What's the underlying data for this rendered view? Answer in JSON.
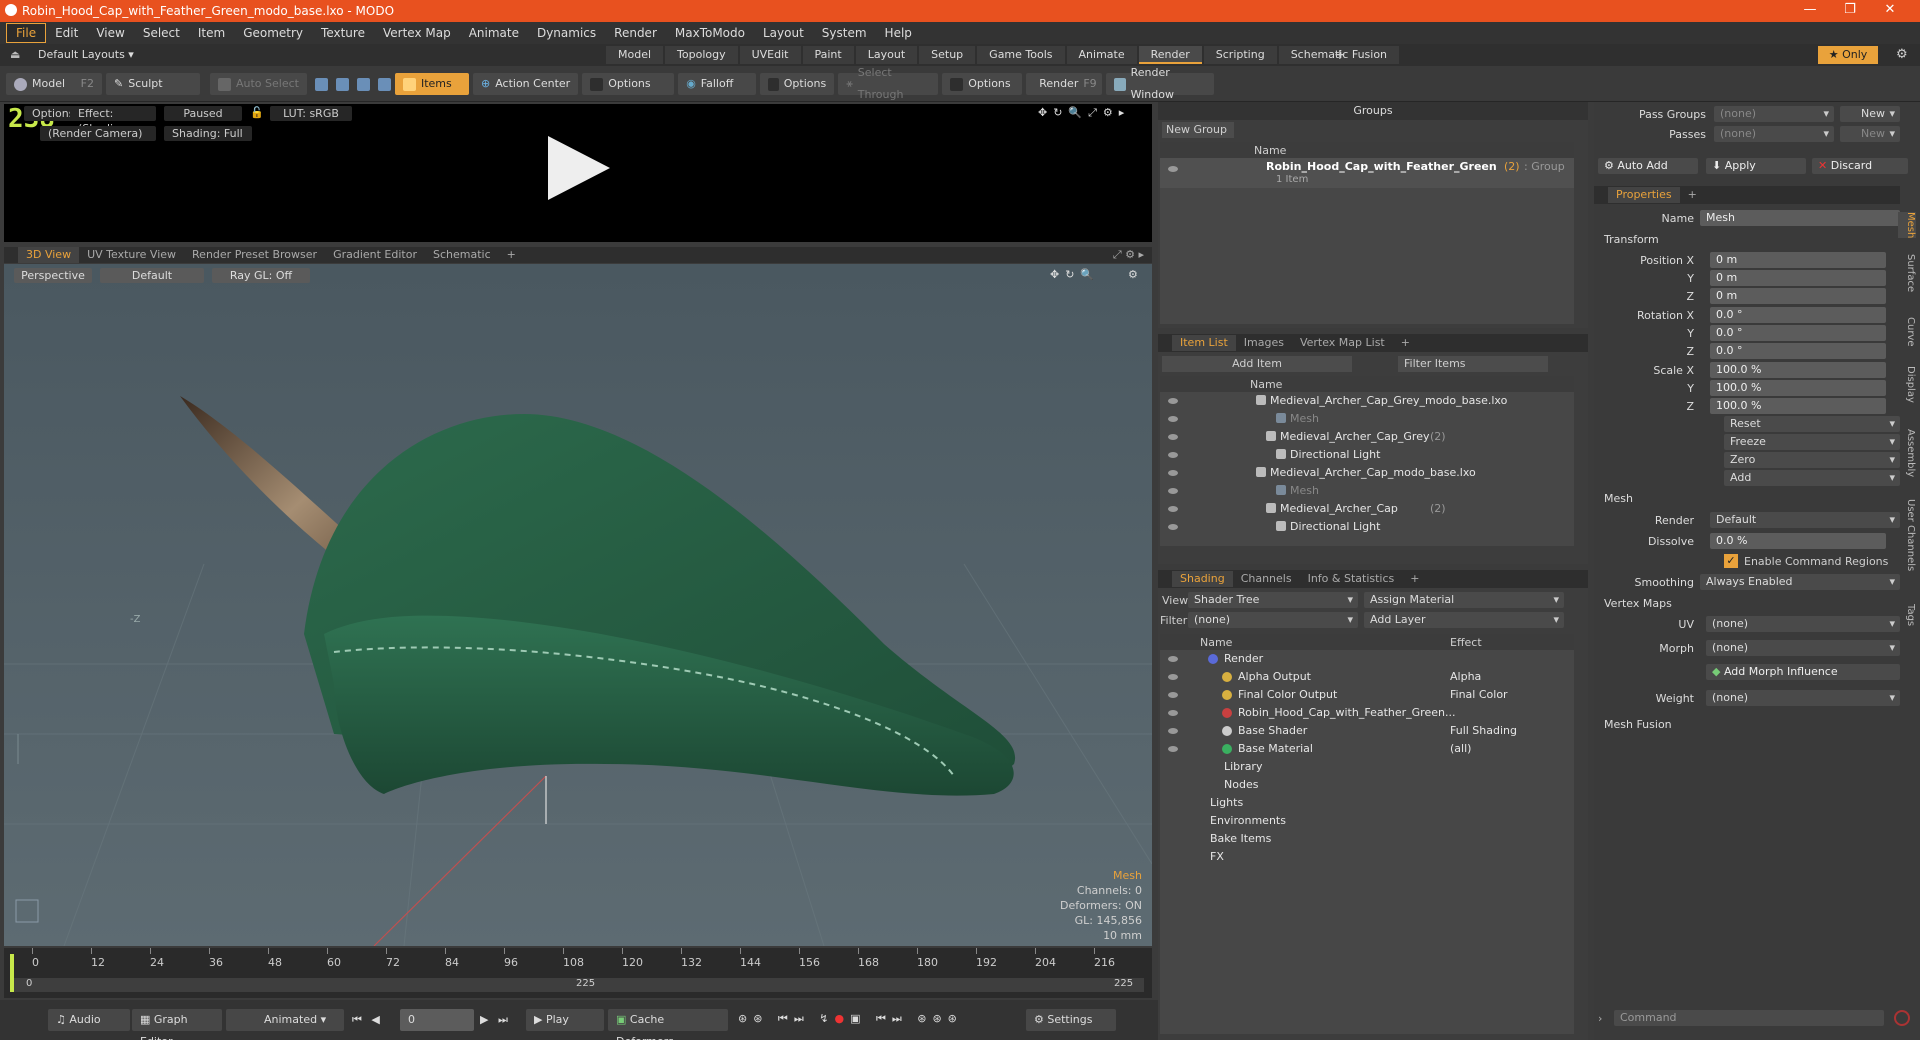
{
  "window": {
    "title": "Robin_Hood_Cap_with_Feather_Green_modo_base.lxo - MODO",
    "minimize": "—",
    "restore": "❐",
    "close": "✕"
  },
  "menu": [
    "File",
    "Edit",
    "View",
    "Select",
    "Item",
    "Geometry",
    "Texture",
    "Vertex Map",
    "Animate",
    "Dynamics",
    "Render",
    "MaxToModo",
    "Layout",
    "System",
    "Help"
  ],
  "layoutbar": {
    "layouts": "Default Layouts ▾",
    "tabs": [
      "Model",
      "Topology",
      "UVEdit",
      "Paint",
      "Layout",
      "Setup",
      "Game Tools",
      "Animate",
      "Render",
      "Scripting",
      "Schematic Fusion"
    ],
    "active": "Render",
    "plus": "+",
    "only": "★ Only"
  },
  "toolbar": {
    "model": "Model",
    "model_key": "F2",
    "sculpt": "Sculpt",
    "auto_select": "Auto Select",
    "items": "Items",
    "action_center": "Action Center",
    "options1": "Options",
    "falloff": "Falloff",
    "options2": "Options",
    "select_through": "Select Through",
    "options3": "Options",
    "render": "Render",
    "render_key": "F9",
    "render_window": "Render Window"
  },
  "preview": {
    "fps": "238",
    "options": "Options",
    "effect": "Effect: (Shadi...",
    "paused": "Paused",
    "lut": "LUT: sRGB",
    "camera": "(Render Camera)",
    "shading": "Shading: Full"
  },
  "viewtabs": {
    "tabs": [
      "3D View",
      "UV Texture View",
      "Render Preset Browser",
      "Gradient Editor",
      "Schematic"
    ],
    "active": "3D View",
    "plus": "+"
  },
  "viewport": {
    "perspective": "Perspective",
    "default": "Default",
    "raygl": "Ray GL: Off",
    "axis_label": "-Z",
    "stats": {
      "title": "Mesh",
      "channels": "Channels: 0",
      "deformers": "Deformers: ON",
      "gl": "GL: 145,856",
      "scale": "10 mm"
    }
  },
  "timeline": {
    "ticks": [
      "0",
      "12",
      "24",
      "36",
      "48",
      "60",
      "72",
      "84",
      "96",
      "108",
      "120",
      "132",
      "144",
      "156",
      "168",
      "180",
      "192",
      "204",
      "216"
    ],
    "low": "0",
    "mid": "225",
    "high": "225"
  },
  "bottombar": {
    "audio": "Audio",
    "graph_editor": "Graph Editor",
    "animated": "Animated",
    "frame": "0",
    "play": "Play",
    "cache_deformers": "Cache Deformers",
    "settings": "Settings"
  },
  "groups": {
    "title": "Groups",
    "new_group": "New Group",
    "col_name": "Name",
    "item_name": "Robin_Hood_Cap_with_Feather_Green",
    "item_count": "(2)",
    "item_type": ": Group",
    "item_sub": "1 Item"
  },
  "itemlist": {
    "tabs": [
      "Item List",
      "Images",
      "Vertex Map List"
    ],
    "plus": "+",
    "add_item": "Add Item",
    "filter": "Filter Items",
    "col_name": "Name",
    "rows": [
      {
        "label": "Medieval_Archer_Cap_Grey_modo_base.lxo",
        "indent": 0,
        "dim": false,
        "count": ""
      },
      {
        "label": "Mesh",
        "indent": 2,
        "dim": true,
        "count": ""
      },
      {
        "label": "Medieval_Archer_Cap_Grey",
        "indent": 1,
        "dim": false,
        "count": "(2)"
      },
      {
        "label": "Directional Light",
        "indent": 2,
        "dim": false,
        "count": ""
      },
      {
        "label": "Medieval_Archer_Cap_modo_base.lxo",
        "indent": 0,
        "dim": false,
        "count": ""
      },
      {
        "label": "Mesh",
        "indent": 2,
        "dim": true,
        "count": ""
      },
      {
        "label": "Medieval_Archer_Cap",
        "indent": 1,
        "dim": false,
        "count": "(2)"
      },
      {
        "label": "Directional Light",
        "indent": 2,
        "dim": false,
        "count": ""
      }
    ]
  },
  "shading": {
    "tabs": [
      "Shading",
      "Channels",
      "Info & Statistics"
    ],
    "plus": "+",
    "view_label": "View",
    "view_value": "Shader Tree",
    "assign": "Assign Material",
    "filter_label": "Filter",
    "filter_value": "(none)",
    "add_layer": "Add Layer",
    "col_name": "Name",
    "col_effect": "Effect",
    "rows": [
      {
        "name": "Render",
        "effect": "",
        "indent": 1
      },
      {
        "name": "Alpha Output",
        "effect": "Alpha",
        "indent": 2
      },
      {
        "name": "Final Color Output",
        "effect": "Final Color",
        "indent": 2
      },
      {
        "name": "Robin_Hood_Cap_with_Feather_Green...",
        "effect": "",
        "indent": 2
      },
      {
        "name": "Base Shader",
        "effect": "Full Shading",
        "indent": 2
      },
      {
        "name": "Base Material",
        "effect": "(all)",
        "indent": 2
      },
      {
        "name": "Library",
        "effect": "",
        "indent": 1
      },
      {
        "name": "Nodes",
        "effect": "",
        "indent": 1
      },
      {
        "name": "Lights",
        "effect": "",
        "indent": 0
      },
      {
        "name": "Environments",
        "effect": "",
        "indent": 0
      },
      {
        "name": "Bake Items",
        "effect": "",
        "indent": 0
      },
      {
        "name": "FX",
        "effect": "",
        "indent": 0
      }
    ]
  },
  "passes": {
    "pass_groups": "Pass Groups",
    "pass_groups_val": "(none)",
    "new": "New",
    "passes": "Passes",
    "passes_val": "(none)",
    "new2": "New",
    "auto_add": "Auto Add",
    "apply": "Apply",
    "discard": "Discard"
  },
  "properties": {
    "tab": "Properties",
    "plus": "+",
    "name_label": "Name",
    "name_value": "Mesh",
    "transform": "Transform",
    "pos_label": "Position X",
    "pos": [
      "0 m",
      "0 m",
      "0 m"
    ],
    "rot_label": "Rotation X",
    "rot": [
      "0.0 °",
      "0.0 °",
      "0.0 °"
    ],
    "scale_label": "Scale X",
    "scale": [
      "100.0 %",
      "100.0 %",
      "100.0 %"
    ],
    "y": "Y",
    "z": "Z",
    "reset": "Reset",
    "freeze": "Freeze",
    "zero": "Zero",
    "add": "Add",
    "mesh": "Mesh",
    "render_label": "Render",
    "render_value": "Default",
    "dissolve_label": "Dissolve",
    "dissolve_value": "0.0 %",
    "enable_cmd": "Enable Command Regions",
    "smoothing_label": "Smoothing",
    "smoothing_value": "Always Enabled",
    "vertex_maps": "Vertex Maps",
    "uv_label": "UV",
    "uv_value": "(none)",
    "morph_label": "Morph",
    "morph_value": "(none)",
    "add_morph": "Add Morph Influence",
    "weight_label": "Weight",
    "weight_value": "(none)",
    "mesh_fusion": "Mesh Fusion",
    "vtabs": [
      "Mesh",
      "Surface",
      "Curve",
      "Display",
      "Assembly",
      "User Channels",
      "Tags"
    ],
    "command": "Command"
  },
  "colors": {
    "accent": "#e9a23b",
    "title": "#e8511f",
    "hat": "#2f6b4f",
    "viewport": "#526068"
  }
}
